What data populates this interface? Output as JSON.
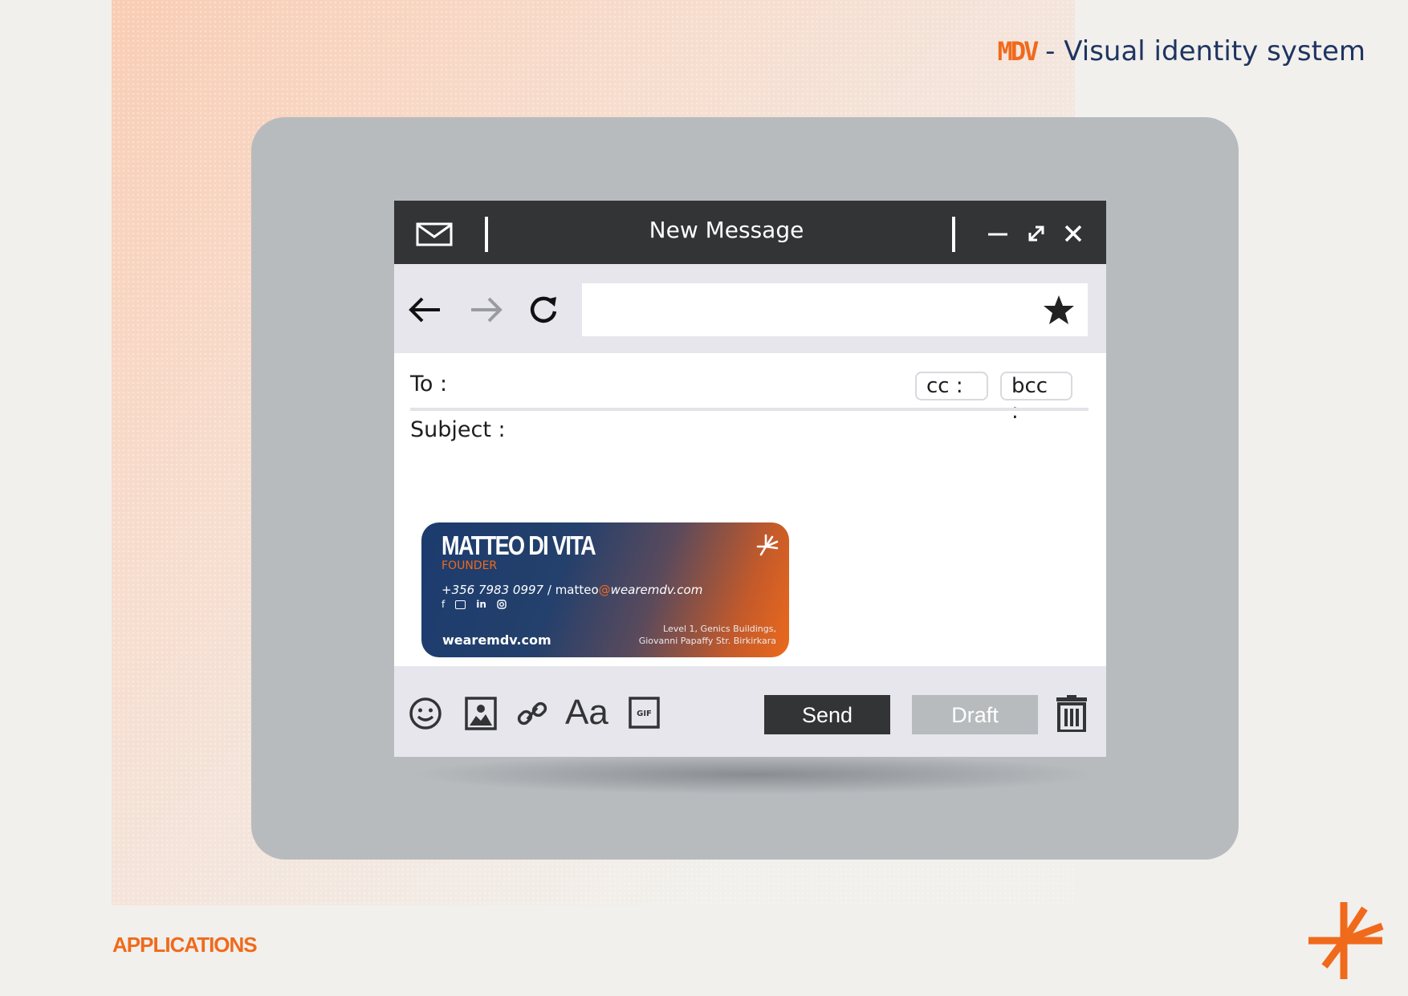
{
  "header": {
    "brand": "MDV",
    "separator": " - ",
    "title": "Visual identity system"
  },
  "footer": {
    "section_label": "APPLICATIONS"
  },
  "window": {
    "title": "New Message"
  },
  "compose": {
    "to_label": "To :",
    "cc_label": "cc :",
    "bcc_label": "bcc :",
    "subject_label": "Subject :"
  },
  "signature": {
    "name": "MATTEO DI VITA",
    "role": "FOUNDER",
    "phone": "+356 7983 0997",
    "contact_sep": " / ",
    "email_user": "matteo",
    "email_at": "@",
    "email_domain": "wearemdv.com",
    "social": [
      "f",
      "in"
    ],
    "website": "wearemdv.com",
    "address_line1": "Level 1, Genics Buildings,",
    "address_line2": "Giovanni Papaffy Str. Birkirkara"
  },
  "toolbar": {
    "font_label": "Aa",
    "gif_label": "GIF",
    "send_label": "Send",
    "draft_label": "Draft"
  },
  "colors": {
    "brand_orange": "#f06a1c",
    "brand_navy": "#1f3461",
    "titlebar": "#333436",
    "device_frame": "#b8bbbe"
  }
}
